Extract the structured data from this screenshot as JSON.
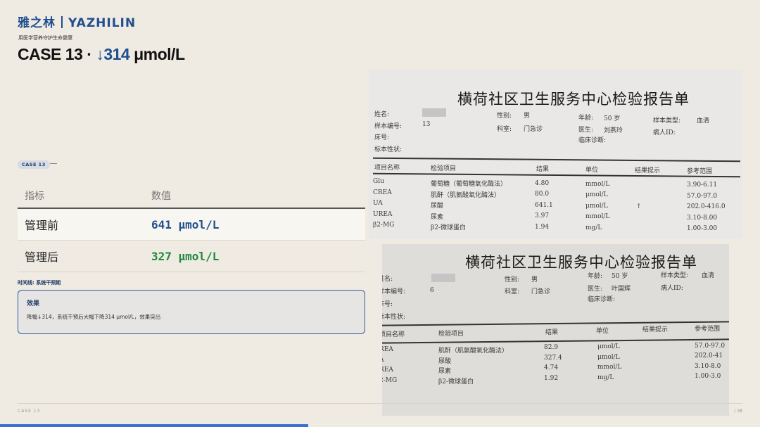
{
  "brand": {
    "name_cn": "雅之林",
    "name_en": "YAZHILIN",
    "tagline": "用医学营养守护生命健康"
  },
  "title": {
    "prefix": "CASE 13 · ",
    "arrow": "↓314",
    "suffix": " μmol/L"
  },
  "case_badge": "CASE 13",
  "table": {
    "headers": [
      "指标",
      "数值"
    ],
    "rows": [
      {
        "label": "管理前",
        "value": "641 μmol/L"
      },
      {
        "label": "管理后",
        "value": "327 μmol/L"
      }
    ]
  },
  "timeline": "时间线: 系统干预期",
  "effect": {
    "title": "效果",
    "text": "降幅↓314，系统干预后大幅下降314 μmol/L，效果突出"
  },
  "footer": {
    "left": "CASE 13",
    "right": "/ 38"
  },
  "progress": 0.406,
  "report1": {
    "title": "横荷社区卫生服务中心检验报告单",
    "name_label": "姓名:",
    "sample_no_label": "样本编号:",
    "sample_no": "13",
    "bed_label": "床号:",
    "sample_prop_label": "标本性状:",
    "sex_label": "性别:",
    "sex": "男",
    "dept_label": "科室:",
    "dept": "门急诊",
    "age_label": "年龄:",
    "age": "50 岁",
    "doctor_label": "医生:",
    "doctor": "刘燕玲",
    "diag_label": "临床诊断:",
    "stype_label": "样本类型:",
    "stype": "血清",
    "pid_label": "病人ID:",
    "headers": [
      "项目名称",
      "检验项目",
      "结果",
      "单位",
      "结果提示",
      "参考范围"
    ],
    "rows": [
      {
        "code": "Glu",
        "name": "葡萄糖（葡萄糖氧化酶法）",
        "result": "4.80",
        "unit": "mmol/L",
        "flag": "",
        "ref": "3.90-6.11"
      },
      {
        "code": "CREA",
        "name": "肌酐（肌氨酸氧化酶法）",
        "result": "80.0",
        "unit": "μmol/L",
        "flag": "",
        "ref": "57.0-97.0"
      },
      {
        "code": "UA",
        "name": "尿酸",
        "result": "641.1",
        "unit": "μmol/L",
        "flag": "↑",
        "ref": "202.0-416.0"
      },
      {
        "code": "UREA",
        "name": "尿素",
        "result": "3.97",
        "unit": "mmol/L",
        "flag": "",
        "ref": "3.10-8.00"
      },
      {
        "code": "β2-MG",
        "name": "β2-微球蛋白",
        "result": "1.94",
        "unit": "mg/L",
        "flag": "",
        "ref": "1.00-3.00"
      }
    ]
  },
  "report2": {
    "title": "横荷社区卫生服务中心检验报告单",
    "name_label": "姓名:",
    "sample_no_label": "样本编号:",
    "sample_no": "6",
    "bed_label": "床号:",
    "sample_prop_label": "标本性状:",
    "sex_label": "性别:",
    "sex": "男",
    "dept_label": "科室:",
    "dept": "门急诊",
    "age_label": "年龄:",
    "age": "50 岁",
    "doctor_label": "医生:",
    "doctor": "叶国辉",
    "diag_label": "临床诊断:",
    "stype_label": "样本类型:",
    "stype": "血清",
    "pid_label": "病人ID:",
    "headers": [
      "项目名称",
      "检验项目",
      "结果",
      "单位",
      "结果提示",
      "参考范围"
    ],
    "rows": [
      {
        "code": "REA",
        "name": "肌酐（肌氨酸氧化酶法）",
        "result": "82.9",
        "unit": "μmol/L",
        "ref": "57.0-97.0"
      },
      {
        "code": "A",
        "name": "尿酸",
        "result": "327.4",
        "unit": "μmol/L",
        "ref": "202.0-41"
      },
      {
        "code": "REA",
        "name": "尿素",
        "result": "4.74",
        "unit": "mmol/L",
        "ref": "3.10-8.0"
      },
      {
        "code": "2-MG",
        "name": "β2-微球蛋白",
        "result": "1.92",
        "unit": "mg/L",
        "ref": "1.00-3.0"
      }
    ]
  }
}
